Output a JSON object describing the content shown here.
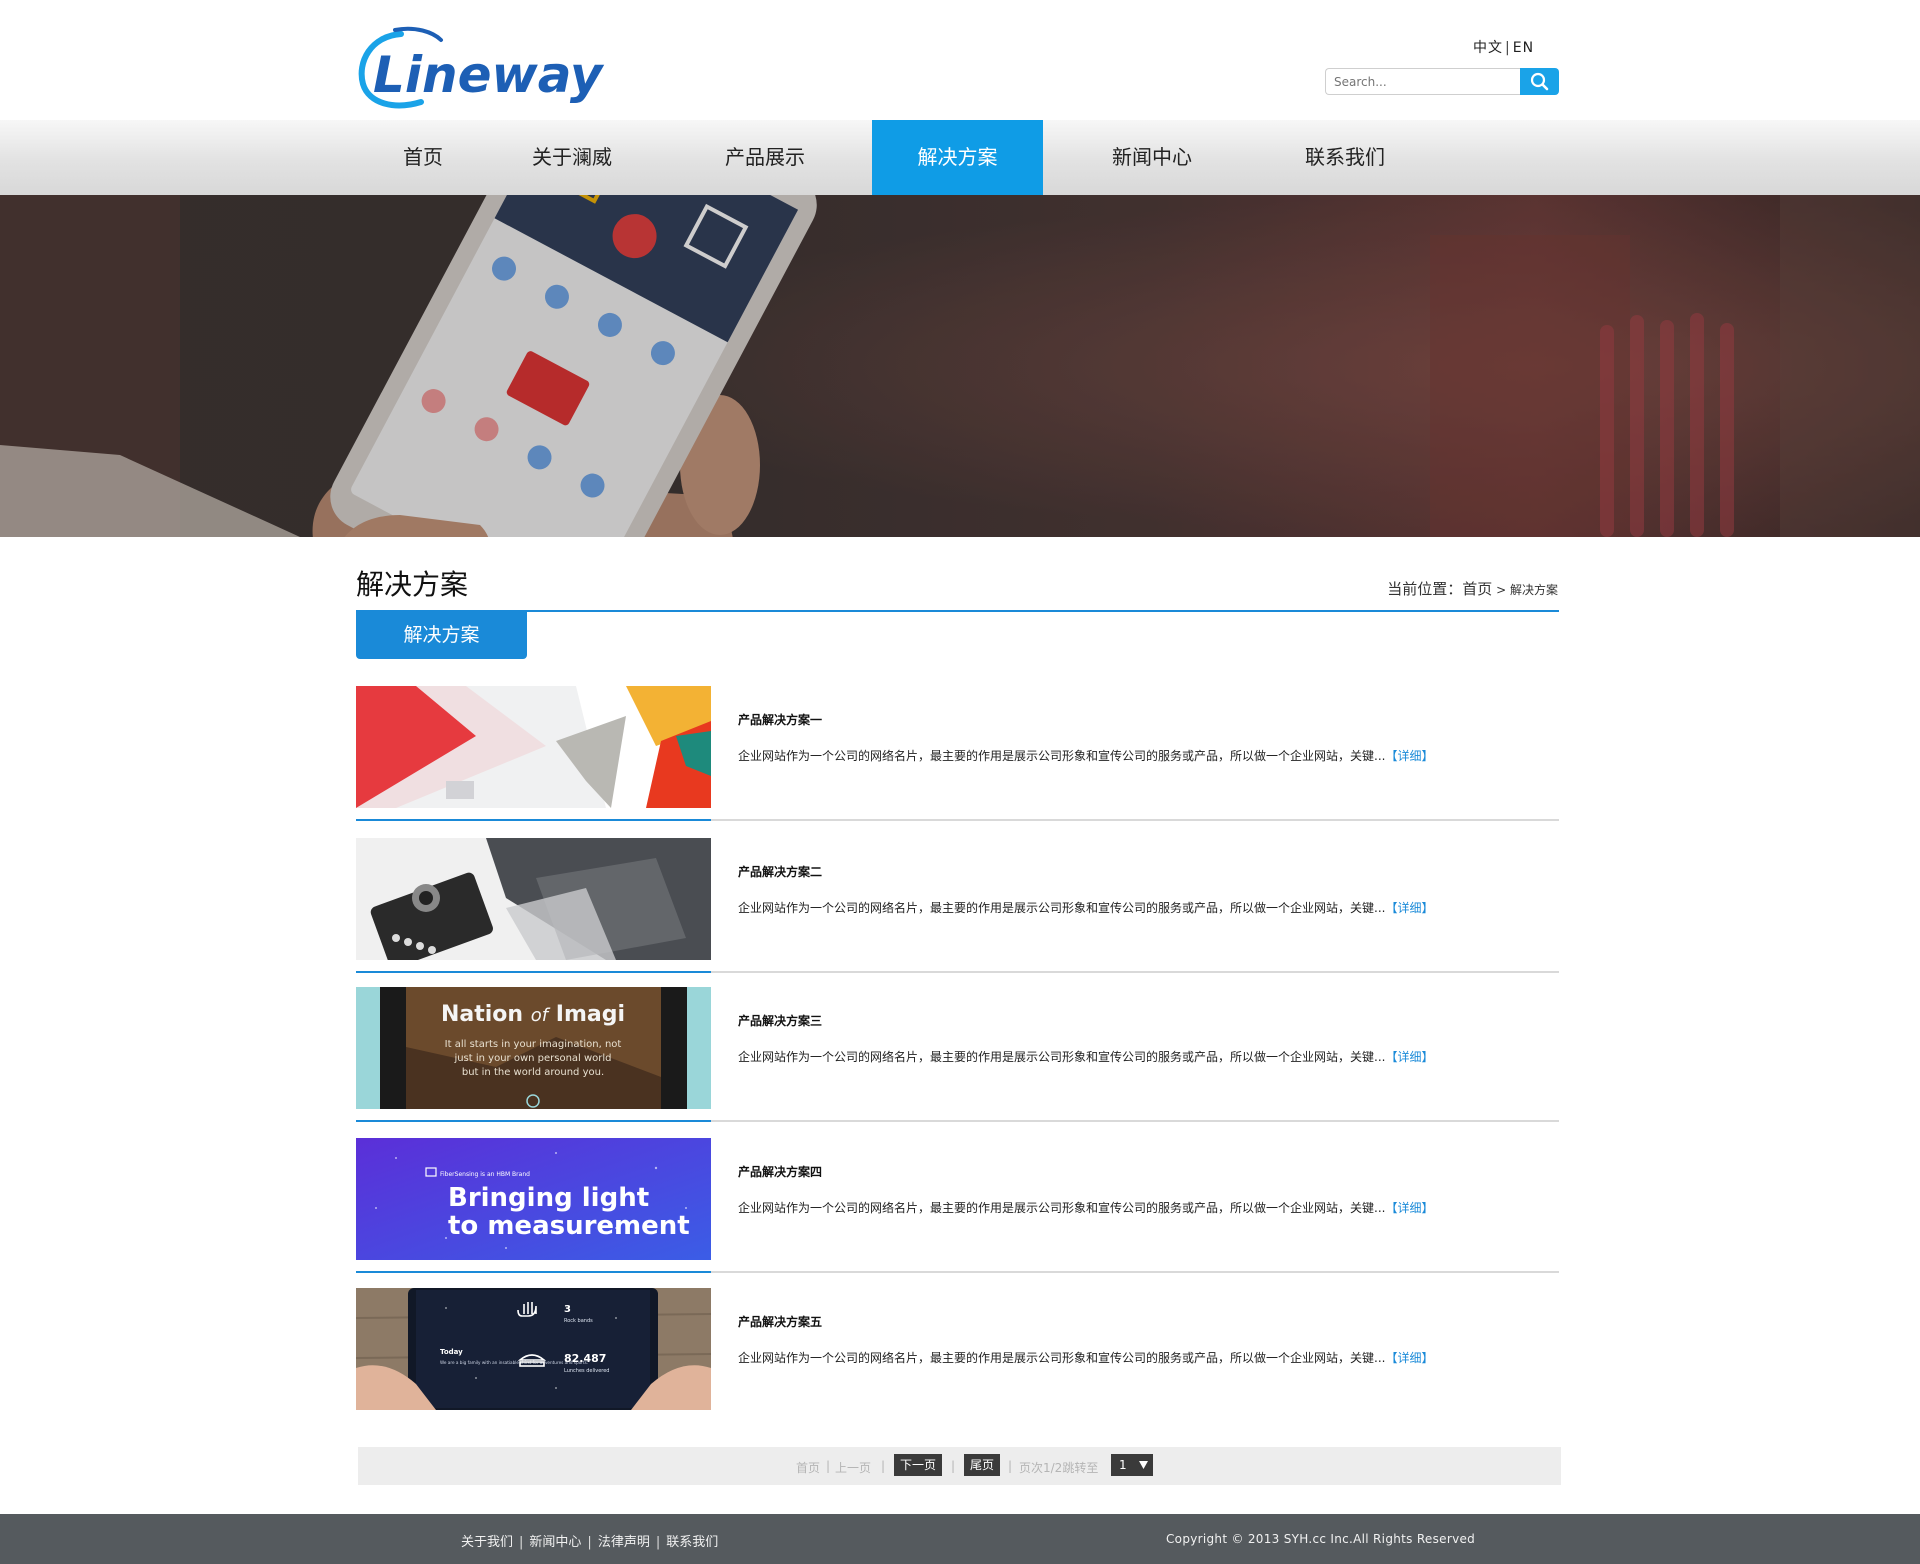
{
  "header": {
    "logo_text": "Lineway",
    "lang_cn": "中文",
    "lang_sep": "|",
    "lang_en": "EN",
    "search_placeholder": "Search..."
  },
  "nav": {
    "items": [
      {
        "label": "首页"
      },
      {
        "label": "关于澜威"
      },
      {
        "label": "产品展示"
      },
      {
        "label": "解决方案"
      },
      {
        "label": "新闻中心"
      },
      {
        "label": "联系我们"
      }
    ],
    "active_index": 3
  },
  "main": {
    "page_title": "解决方案",
    "breadcrumb": {
      "prefix": "当前位置：",
      "home": "首页",
      "separator": " > ",
      "current": "解决方案"
    },
    "category_tab": "解决方案",
    "items": [
      {
        "title": "产品解决方案一",
        "desc": "企业网站作为一个公司的网络名片，最主要的作用是展示公司形象和宣传公司的服务或产品，所以做一个企业网站，关键...",
        "more": "【详细】"
      },
      {
        "title": "产品解决方案二",
        "desc": "企业网站作为一个公司的网络名片，最主要的作用是展示公司形象和宣传公司的服务或产品，所以做一个企业网站，关键...",
        "more": "【详细】"
      },
      {
        "title": "产品解决方案三",
        "desc": "企业网站作为一个公司的网络名片，最主要的作用是展示公司形象和宣传公司的服务或产品，所以做一个企业网站，关键...",
        "more": "【详细】"
      },
      {
        "title": "产品解决方案四",
        "desc": "企业网站作为一个公司的网络名片，最主要的作用是展示公司形象和宣传公司的服务或产品，所以做一个企业网站，关键...",
        "more": "【详细】"
      },
      {
        "title": "产品解决方案五",
        "desc": "企业网站作为一个公司的网络名片，最主要的作用是展示公司形象和宣传公司的服务或产品，所以做一个企业网站，关键...",
        "more": "【详细】"
      }
    ],
    "thumb_texts": {
      "nation_title_a": "Nation",
      "nation_title_of": "of",
      "nation_title_b": "Imagi",
      "nation_sub": [
        "It all starts in your imagination, not",
        "just in your own personal world",
        "but in the world around you."
      ],
      "fiber_brand": "FiberSensing is an HBM Brand",
      "fiber_line1": "Bringing light",
      "fiber_line2": "to measurement",
      "tablet_today": "Today",
      "tablet_note": "We are a big family with an insatiable thirst for adventures and sports.",
      "tablet_num1": "3",
      "tablet_lbl1": "Rock bands",
      "tablet_num2": "82.487",
      "tablet_lbl2": "Lunches delivered"
    }
  },
  "pagination": {
    "first": "首页",
    "prev": "上一页",
    "next": "下一页",
    "last": "尾页",
    "info": "页次1/2跳转至",
    "select_value": "1",
    "sep": "|"
  },
  "footer": {
    "links": [
      "关于我们",
      "新闻中心",
      "法律声明",
      "联系我们"
    ],
    "copyright": "Copyright © 2013 SYH.cc Inc.All Rights Reserved"
  },
  "colors": {
    "accent": "#0f9ce6",
    "dark_blue": "#1a8ad8",
    "footer_bg": "#555a5e",
    "logo_blue": "#1d5fb5"
  }
}
